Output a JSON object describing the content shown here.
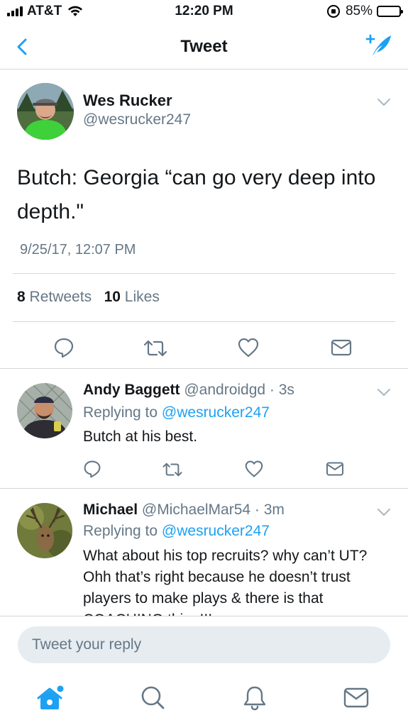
{
  "status_bar": {
    "carrier": "AT&T",
    "time": "12:20 PM",
    "battery": "85%",
    "battery_level": 0.85
  },
  "nav": {
    "title": "Tweet",
    "back_icon": "chevron-left-icon",
    "compose_icon": "compose-tweet-icon"
  },
  "tweet": {
    "author_name": "Wes Rucker",
    "author_handle": "@wesrucker247",
    "text": "Butch: Georgia “can go very deep into depth.\"",
    "timestamp": "9/25/17, 12:07 PM",
    "retweets_count": "8",
    "retweets_label": "Retweets",
    "likes_count": "10",
    "likes_label": "Likes"
  },
  "replies": [
    {
      "name": "Andy Baggett",
      "meta": "@androidgd · 3s",
      "replying_prefix": "Replying to",
      "replying_handle": "@wesrucker247",
      "text": "Butch at his best."
    },
    {
      "name": "Michael",
      "meta": "@MichaelMar54 · 3m",
      "replying_prefix": "Replying to",
      "replying_handle": "@wesrucker247",
      "text": "What about his top recruits? why can’t UT? Ohh that’s right because he doesn’t trust players to make plays & there is that COACHING thing!!!"
    }
  ],
  "reply_bar": {
    "placeholder": "Tweet your reply"
  },
  "tab_bar": {
    "items": [
      "home-icon",
      "search-icon",
      "notifications-icon",
      "messages-icon"
    ]
  },
  "colors": {
    "accent": "#1da1f2",
    "secondary_text": "#657786",
    "divider": "#d3d6d9"
  }
}
